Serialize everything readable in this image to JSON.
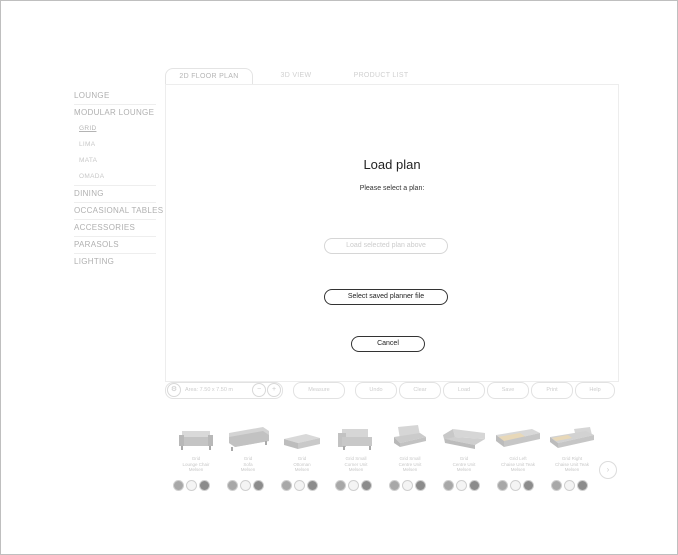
{
  "sidebar": {
    "items": [
      {
        "label": "LOUNGE"
      },
      {
        "label": "MODULAR LOUNGE",
        "subitems": [
          {
            "label": "GRID",
            "active": true
          },
          {
            "label": "LIMA"
          },
          {
            "label": "MATA"
          },
          {
            "label": "OMADA"
          }
        ]
      },
      {
        "label": "DINING"
      },
      {
        "label": "OCCASIONAL TABLES"
      },
      {
        "label": "ACCESSORIES"
      },
      {
        "label": "PARASOLS"
      },
      {
        "label": "LIGHTING"
      }
    ]
  },
  "tabs": [
    {
      "label": "2D FLOOR PLAN",
      "active": true
    },
    {
      "label": "3D VIEW"
    },
    {
      "label": "PRODUCT LIST"
    }
  ],
  "dialog": {
    "title": "Load plan",
    "subtitle": "Please select a plan:",
    "load_selected_label": "Load selected plan above",
    "select_saved_label": "Select saved planner file",
    "cancel_label": "Cancel"
  },
  "toolbar": {
    "area_label": "Area: 7.50 x 7.50 m",
    "minus": "−",
    "plus": "+",
    "settings_icon": "gear-icon",
    "buttons": [
      "Measure",
      "Undo",
      "Clear",
      "Load",
      "Save",
      "Print",
      "Help"
    ]
  },
  "products": [
    {
      "name": "Grid\nLounge Chair\nMelsen",
      "icon": "lounge-chair-icon"
    },
    {
      "name": "Grid\nSofa\nMelsen",
      "icon": "sofa-icon"
    },
    {
      "name": "Grid\nOttoman\nMelsen",
      "icon": "ottoman-icon"
    },
    {
      "name": "Grid Small\nCorner Unit\nMelsen",
      "icon": "small-corner-unit-icon"
    },
    {
      "name": "Grid Small\nCentre Unit\nMelsen",
      "icon": "small-centre-unit-icon"
    },
    {
      "name": "Grid\nCentre Unit\nMelsen",
      "icon": "centre-unit-icon"
    },
    {
      "name": "Grid Left\nChaise Unit Teak\nMelsen",
      "icon": "left-chaise-unit-icon"
    },
    {
      "name": "Grid Right\nChaise Unit Teak\nMelsen",
      "icon": "right-chaise-unit-icon"
    }
  ],
  "swatch_colors": [
    "#a8a8a8",
    "#f4f4f4",
    "#8c8c8c"
  ],
  "next_icon": "chevron-right-icon",
  "colors": {
    "dialog_border": "#333333",
    "faded_text": "#c8c8c8",
    "panel_border": "#ededed"
  }
}
